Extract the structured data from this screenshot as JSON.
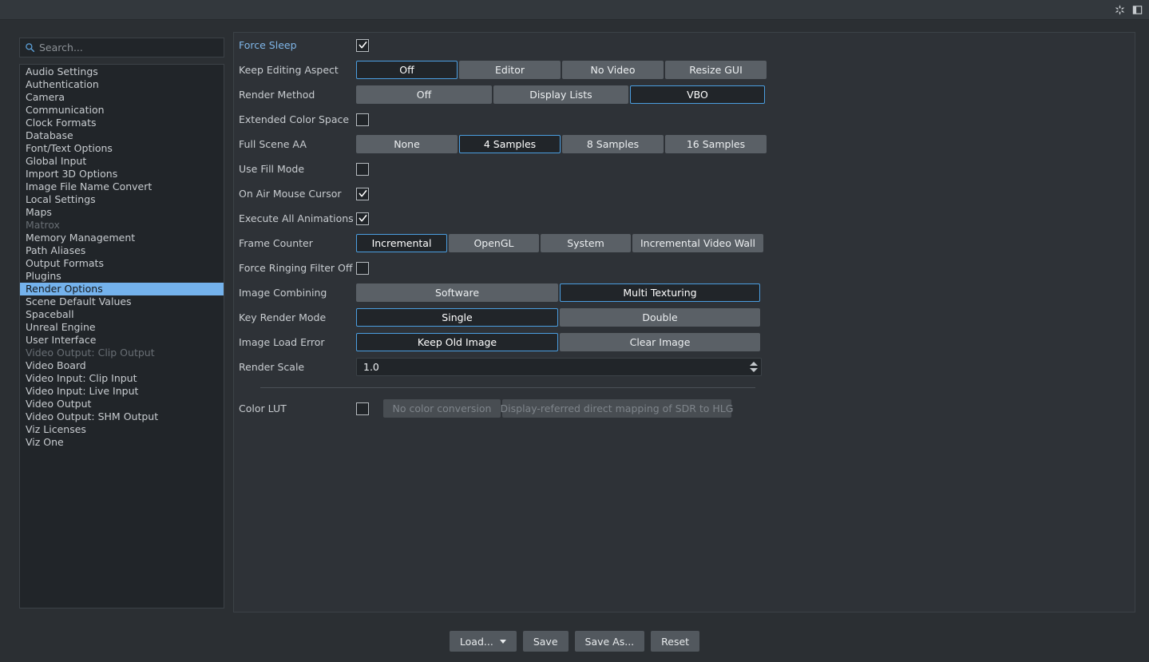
{
  "titlebar": {
    "icons": [
      {
        "name": "snowflake-icon",
        "label": "Freeze"
      },
      {
        "name": "layout-panel-icon",
        "label": "Panel Layout"
      }
    ]
  },
  "sidebar": {
    "search": {
      "placeholder": "Search...",
      "value": "",
      "icon": "search-icon"
    },
    "items": [
      {
        "label": "Audio Settings",
        "state": "normal"
      },
      {
        "label": "Authentication",
        "state": "normal"
      },
      {
        "label": "Camera",
        "state": "normal"
      },
      {
        "label": "Communication",
        "state": "normal"
      },
      {
        "label": "Clock Formats",
        "state": "normal"
      },
      {
        "label": "Database",
        "state": "normal"
      },
      {
        "label": "Font/Text Options",
        "state": "normal"
      },
      {
        "label": "Global Input",
        "state": "normal"
      },
      {
        "label": "Import 3D Options",
        "state": "normal"
      },
      {
        "label": "Image File Name Convert",
        "state": "normal"
      },
      {
        "label": "Local Settings",
        "state": "normal"
      },
      {
        "label": "Maps",
        "state": "normal"
      },
      {
        "label": "Matrox",
        "state": "disabled"
      },
      {
        "label": "Memory Management",
        "state": "normal"
      },
      {
        "label": "Path Aliases",
        "state": "normal"
      },
      {
        "label": "Output Formats",
        "state": "normal"
      },
      {
        "label": "Plugins",
        "state": "normal"
      },
      {
        "label": "Render Options",
        "state": "selected"
      },
      {
        "label": "Scene Default Values",
        "state": "normal"
      },
      {
        "label": "Spaceball",
        "state": "normal"
      },
      {
        "label": "Unreal Engine",
        "state": "normal"
      },
      {
        "label": "User Interface",
        "state": "normal"
      },
      {
        "label": "Video Output: Clip Output",
        "state": "disabled"
      },
      {
        "label": "Video Board",
        "state": "normal"
      },
      {
        "label": "Video Input: Clip Input",
        "state": "normal"
      },
      {
        "label": "Video Input: Live Input",
        "state": "normal"
      },
      {
        "label": "Video Output",
        "state": "normal"
      },
      {
        "label": "Video Output: SHM Output",
        "state": "normal"
      },
      {
        "label": "Viz Licenses",
        "state": "normal"
      },
      {
        "label": "Viz One",
        "state": "normal"
      }
    ]
  },
  "settings": {
    "rows": [
      {
        "label": "Force Sleep",
        "accent": true,
        "type": "checkbox",
        "checked": true
      },
      {
        "label": "Keep Editing Aspect",
        "type": "segmented",
        "options": [
          "Off",
          "Editor",
          "No Video",
          "Resize GUI"
        ],
        "selected": 0,
        "widths": [
          127,
          127,
          127,
          127
        ]
      },
      {
        "label": "Render Method",
        "type": "segmented",
        "options": [
          "Off",
          "Display Lists",
          "VBO"
        ],
        "selected": 2,
        "widths": [
          170,
          169,
          169
        ]
      },
      {
        "label": "Extended Color Space",
        "type": "checkbox",
        "checked": false
      },
      {
        "label": "Full Scene AA",
        "type": "segmented",
        "options": [
          "None",
          "4 Samples",
          "8 Samples",
          "16 Samples"
        ],
        "selected": 1,
        "widths": [
          127,
          127,
          127,
          127
        ]
      },
      {
        "label": "Use Fill Mode",
        "type": "checkbox",
        "checked": false
      },
      {
        "label": "On Air Mouse Cursor",
        "type": "checkbox",
        "checked": true
      },
      {
        "label": "Execute All Animations",
        "type": "checkbox",
        "checked": true
      },
      {
        "label": "Frame Counter",
        "type": "segmented",
        "options": [
          "Incremental",
          "OpenGL",
          "System",
          "Incremental Video Wall"
        ],
        "selected": 0,
        "widths": [
          114,
          113,
          113,
          164
        ]
      },
      {
        "label": "Force Ringing Filter Off",
        "type": "checkbox",
        "checked": false
      },
      {
        "label": "Image Combining",
        "type": "segmented",
        "options": [
          "Software",
          "Multi Texturing"
        ],
        "selected": 1,
        "widths": [
          253,
          251
        ]
      },
      {
        "label": "Key Render Mode",
        "type": "segmented",
        "options": [
          "Single",
          "Double"
        ],
        "selected": 0,
        "widths": [
          253,
          251
        ]
      },
      {
        "label": "Image Load Error",
        "type": "segmented",
        "options": [
          "Keep Old Image",
          "Clear Image"
        ],
        "selected": 0,
        "widths": [
          253,
          251
        ]
      },
      {
        "label": "Render Scale",
        "type": "spinner",
        "value": "1.0"
      },
      {
        "type": "divider"
      },
      {
        "label": "Color LUT",
        "type": "checkbox-segmented",
        "checked": false,
        "options": [
          "No color conversion",
          "Display-referred direct mapping of SDR to HLG"
        ],
        "disabled": true,
        "widths": [
          147,
          287
        ]
      }
    ]
  },
  "footer": {
    "buttons": [
      {
        "label": "Load...",
        "name": "load-button",
        "caret": true
      },
      {
        "label": "Save",
        "name": "save-button",
        "caret": false
      },
      {
        "label": "Save As...",
        "name": "save-as-button",
        "caret": false
      },
      {
        "label": "Reset",
        "name": "reset-button",
        "caret": false
      }
    ]
  },
  "colors": {
    "accent": "#7fb6e8",
    "selection": "#74b2ec",
    "segment_active_border": "#4b9ee0",
    "panel_bg": "#2e3237",
    "window_bg": "#2b2f33"
  }
}
